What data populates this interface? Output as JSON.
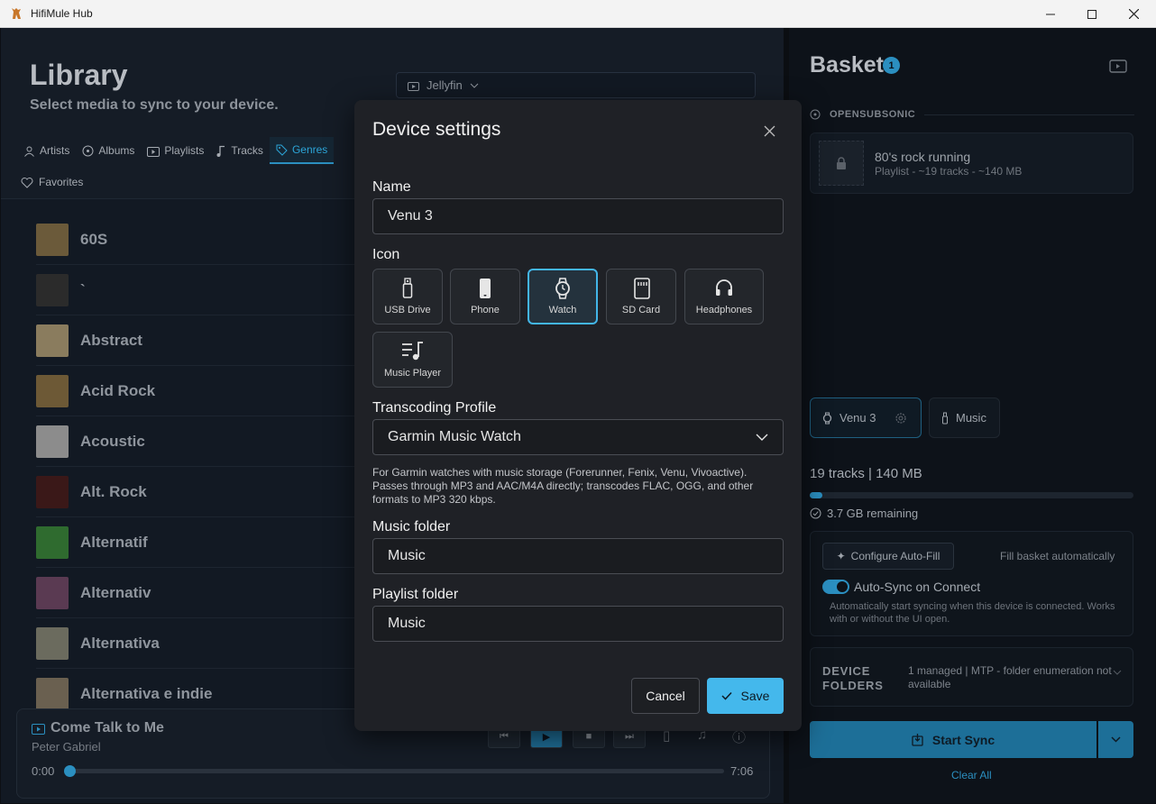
{
  "window": {
    "title": "HifiMule Hub"
  },
  "library": {
    "title": "Library",
    "subtitle": "Select media to sync to your device.",
    "source": "Jellyfin",
    "tabs": [
      {
        "label": "Artists",
        "icon": "person-icon"
      },
      {
        "label": "Albums",
        "icon": "disc-icon"
      },
      {
        "label": "Playlists",
        "icon": "playlist-icon"
      },
      {
        "label": "Tracks",
        "icon": "note-icon"
      },
      {
        "label": "Genres",
        "icon": "tag-icon",
        "active": true
      }
    ],
    "favorites_label": "Favorites",
    "genres": [
      {
        "name": "60S",
        "color": "#6b5a3a"
      },
      {
        "name": "`",
        "color": "#2b2b2b"
      },
      {
        "name": "Abstract",
        "color": "#8a7c5e"
      },
      {
        "name": "Acid Rock",
        "color": "#6d5936"
      },
      {
        "name": "Acoustic",
        "color": "#8c8c8c"
      },
      {
        "name": "Alt. Rock",
        "color": "#3a1818"
      },
      {
        "name": "Alternatif",
        "color": "#2f6b2f"
      },
      {
        "name": "Alternativ",
        "color": "#5a3a52"
      },
      {
        "name": "Alternativa",
        "color": "#6b6b5e"
      },
      {
        "name": "Alternativa e indie",
        "color": "#6a6050"
      }
    ]
  },
  "player": {
    "title": "Come Talk to Me",
    "artist": "Peter Gabriel",
    "time_start": "0:00",
    "time_end": "7:06",
    "progress": 0.0
  },
  "basket": {
    "title": "Basket",
    "badge": "1",
    "section": "OPENSUBSONIC",
    "item_title": "80's rock running",
    "item_sub": "Playlist - ~19 tracks - ~140 MB",
    "devices": [
      {
        "label": "Venu 3",
        "active": true
      },
      {
        "label": "Music",
        "active": false
      }
    ],
    "tracks_info": "19 tracks | 140 MB",
    "storage_fraction": 0.04,
    "remaining": "3.7 GB remaining",
    "configure_label": "Configure Auto-Fill",
    "fill_auto_label": "Fill basket automatically",
    "autosync_label": "Auto-Sync on Connect",
    "autosync_desc": "Automatically start syncing when this device is connected. Works with or without the UI open.",
    "autosync_on": true,
    "device_folders_label": "DEVICE FOLDERS",
    "device_folders_info": "1 managed | MTP - folder enumeration not available",
    "start_sync": "Start Sync",
    "clear_all": "Clear All"
  },
  "dialog": {
    "title": "Device settings",
    "name_label": "Name",
    "name_value": "Venu 3",
    "icon_label": "Icon",
    "icons": [
      {
        "label": "USB Drive",
        "icon": "usb-icon"
      },
      {
        "label": "Phone",
        "icon": "phone-icon"
      },
      {
        "label": "Watch",
        "icon": "watch-icon",
        "selected": true
      },
      {
        "label": "SD Card",
        "icon": "sd-card-icon"
      },
      {
        "label": "Headphones",
        "icon": "headphones-icon"
      },
      {
        "label": "Music Player",
        "icon": "music-player-icon"
      }
    ],
    "profile_label": "Transcoding Profile",
    "profile_value": "Garmin Music Watch",
    "profile_help": "For Garmin watches with music storage (Forerunner, Fenix, Venu, Vivoactive). Passes through MP3 and AAC/M4A directly; transcodes FLAC, OGG, and other formats to MP3 320 kbps.",
    "music_folder_label": "Music folder",
    "music_folder_value": "Music",
    "playlist_folder_label": "Playlist folder",
    "playlist_folder_value": "Music",
    "cancel_label": "Cancel",
    "save_label": "Save"
  },
  "colors": {
    "accent": "#44b8ec",
    "accent_dark": "#2b8fc0",
    "dialog_bg": "#1f2126"
  }
}
